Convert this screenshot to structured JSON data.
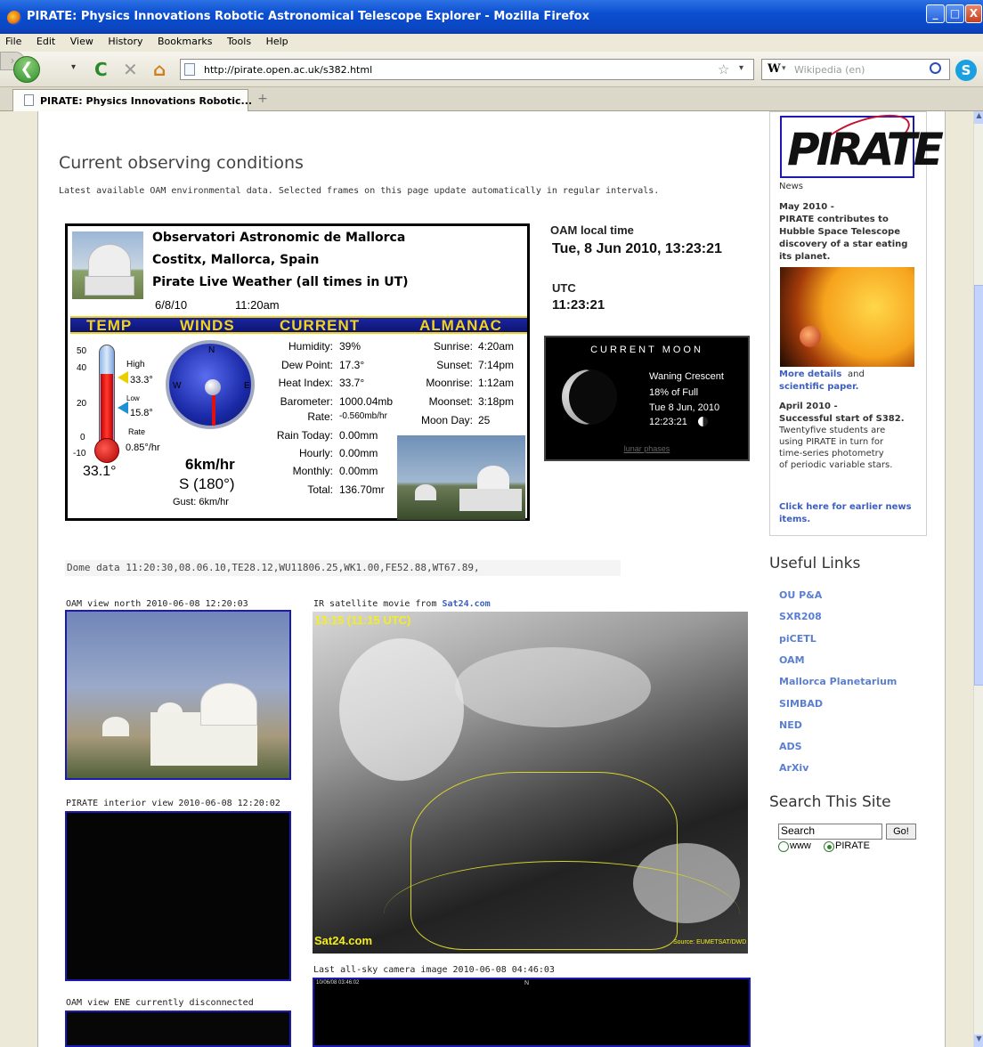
{
  "window": {
    "title": "PIRATE: Physics Innovations Robotic Astronomical Telescope Explorer - Mozilla Firefox",
    "min": "_",
    "max": "□",
    "close": "X"
  },
  "menu": [
    "File",
    "Edit",
    "View",
    "History",
    "Bookmarks",
    "Tools",
    "Help"
  ],
  "nav": {
    "back": "❮",
    "forward": "›",
    "reload": "C",
    "stop": "✕",
    "home": "⌂",
    "url": "http://pirate.open.ac.uk/s382.html",
    "bookmark_star": "☆",
    "url_dropdown": "▾",
    "search_engine": "W",
    "search_engine_dd": "▾",
    "search_placeholder": "Wikipedia (en)"
  },
  "tabs": [
    {
      "label": "PIRATE: Physics Innovations Robotic..."
    }
  ],
  "new_tab": "+",
  "main": {
    "heading": "Current observing conditions",
    "intro": "Latest available OAM environmental data. Selected frames on this page update automatically in regular intervals.",
    "weather": {
      "site": "Observatori Astronomic de  Mallorca",
      "location": "Costitx, Mallorca, Spain",
      "subtitle": "Pirate Live Weather (all times in UT)",
      "date": "6/8/10",
      "time": "11:20am",
      "headers": {
        "temp": "TEMP",
        "winds": "WINDS",
        "current": "CURRENT",
        "almanac": "ALMANAC"
      },
      "temp_ticks": [
        "50",
        "40",
        "20",
        "0",
        "-10"
      ],
      "high_label": "High",
      "high": "33.3°",
      "low_label": "Low",
      "low": "15.8°",
      "rate_label": "Rate",
      "rate": "0.85°/hr",
      "temp_now": "33.1°",
      "temp_fill_fraction": 0.72,
      "compass": {
        "n": "N",
        "w": "W",
        "e": "E"
      },
      "wind_speed": "6km/hr",
      "wind_dir": "S (180°)",
      "gust": "Gust:  6km/hr",
      "current": [
        {
          "label": "Humidity:",
          "value": "39%"
        },
        {
          "label": "Dew Point:",
          "value": "17.3°"
        },
        {
          "label": "Heat Index:",
          "value": "33.7°"
        },
        {
          "label": "Barometer:",
          "value": "1000.04mb"
        },
        {
          "label": "Rate:",
          "value": "-0.560mb/hr"
        },
        {
          "label": "Rain Today:",
          "value": "0.00mm"
        },
        {
          "label": "Hourly:",
          "value": "0.00mm"
        },
        {
          "label": "Monthly:",
          "value": "0.00mm"
        },
        {
          "label": "Total:",
          "value": "136.70mr"
        }
      ],
      "almanac": [
        {
          "label": "Sunrise:",
          "value": "4:20am"
        },
        {
          "label": "Sunset:",
          "value": "7:14pm"
        },
        {
          "label": "Moonrise:",
          "value": "1:12am"
        },
        {
          "label": "Moonset:",
          "value": "3:18pm"
        },
        {
          "label": "Moon Day:",
          "value": "25"
        }
      ]
    },
    "local_time_label": "OAM local time",
    "local_time": "Tue, 8 Jun 2010, 13:23:21",
    "utc_label": "UTC",
    "utc_time": "11:23:21",
    "moon": {
      "header": "CURRENT MOON",
      "phase": "Waning Crescent",
      "full": "18% of Full",
      "date": "Tue 8 Jun, 2010",
      "time": "12:23:21",
      "link": "lunar phases"
    },
    "dome_data": "Dome data 11:20:30,08.06.10,TE28.12,WU11806.25,WK1.00,FE52.88,WT67.89,",
    "cam_north": "OAM view north 2010-06-08 12:20:03",
    "cam_interior": "PIRATE interior view 2010-06-08 12:20:02",
    "cam_ene": "OAM view ENE currently disconnected",
    "sat_caption": "IR satellite movie from",
    "sat_link": "Sat24.com",
    "sat_stamp": "13:15 (11:15 UTC)",
    "sat_logo": "Sat24.com",
    "sat_source": "Source: EUMETSAT/DWD",
    "allsky_caption": "Last all-sky camera image 2010-06-08 04:46:03",
    "allsky_stamp": "10/06/08 03:46:02",
    "allsky_n": "N"
  },
  "sidebar": {
    "logo": "PIRATE",
    "news_label": "News",
    "news1_date": "May 2010 -",
    "news1_title": [
      "PIRATE contributes to",
      "Hubble Space Telescope",
      "discovery of a star eating",
      "its planet."
    ],
    "more_details": "More details",
    "and": "and",
    "sci_paper": "scientific paper.",
    "news2_date": "April 2010 -",
    "news2_title": "Successful start of S382.",
    "news2_body": [
      "Twentyfive students are",
      "using PIRATE in turn for",
      "time-series photometry",
      "of periodic variable stars."
    ],
    "earlier": [
      "Click here for earlier news",
      "items."
    ],
    "useful_heading": "Useful Links",
    "links": [
      "OU P&A",
      "SXR208",
      "piCETL",
      "OAM",
      "Mallorca Planetarium",
      "SIMBAD",
      "NED",
      "ADS",
      "ArXiv"
    ],
    "search_heading": "Search This Site",
    "search_value": "Search",
    "go": "Go!",
    "radio_www": "www",
    "radio_pirate": "PIRATE"
  },
  "scroll": {
    "up": "▲",
    "down": "▼"
  }
}
